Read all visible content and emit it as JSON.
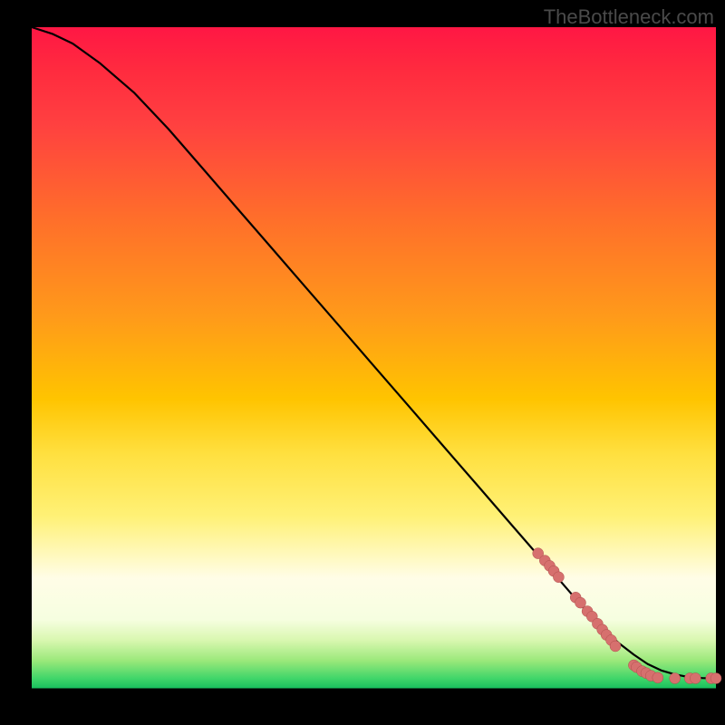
{
  "attribution": "TheBottleneck.com",
  "colors": {
    "curve": "#000000",
    "marker_fill": "#d6706e",
    "marker_stroke": "#b04f4c",
    "background_black": "#000000"
  },
  "chart_data": {
    "type": "line",
    "title": "",
    "xlabel": "",
    "ylabel": "",
    "xlim": [
      0,
      100
    ],
    "ylim": [
      0,
      100
    ],
    "curve": {
      "x": [
        0,
        3,
        6,
        10,
        15,
        20,
        25,
        30,
        35,
        40,
        45,
        50,
        55,
        60,
        65,
        70,
        75,
        80,
        82,
        84,
        86,
        88,
        90,
        92,
        94,
        96,
        98,
        100
      ],
      "y": [
        100,
        99,
        97.5,
        94.5,
        90,
        84.5,
        78.5,
        72.5,
        66.5,
        60.5,
        54.5,
        48.5,
        42.5,
        36.5,
        30.5,
        24.5,
        18.5,
        12.5,
        10,
        8,
        6.2,
        4.6,
        3.2,
        2.2,
        1.6,
        1.2,
        1.05,
        1
      ]
    },
    "markers": [
      {
        "x": 74,
        "y": 20.0
      },
      {
        "x": 75,
        "y": 18.9
      },
      {
        "x": 75.7,
        "y": 18.1
      },
      {
        "x": 76.3,
        "y": 17.3
      },
      {
        "x": 77,
        "y": 16.4
      },
      {
        "x": 79.5,
        "y": 13.3
      },
      {
        "x": 80.2,
        "y": 12.5
      },
      {
        "x": 81.2,
        "y": 11.2
      },
      {
        "x": 81.9,
        "y": 10.4
      },
      {
        "x": 82.7,
        "y": 9.3
      },
      {
        "x": 83.4,
        "y": 8.4
      },
      {
        "x": 84.0,
        "y": 7.6
      },
      {
        "x": 84.7,
        "y": 6.8
      },
      {
        "x": 85.3,
        "y": 5.9
      },
      {
        "x": 88.0,
        "y": 3.0
      },
      {
        "x": 88.4,
        "y": 2.7
      },
      {
        "x": 89.2,
        "y": 2.1
      },
      {
        "x": 89.8,
        "y": 1.8
      },
      {
        "x": 90.5,
        "y": 1.4
      },
      {
        "x": 91.5,
        "y": 1.1
      },
      {
        "x": 94.0,
        "y": 1.0
      },
      {
        "x": 96.2,
        "y": 1.0
      },
      {
        "x": 97.0,
        "y": 1.0
      },
      {
        "x": 99.3,
        "y": 1.0
      },
      {
        "x": 100.0,
        "y": 1.0
      }
    ]
  }
}
